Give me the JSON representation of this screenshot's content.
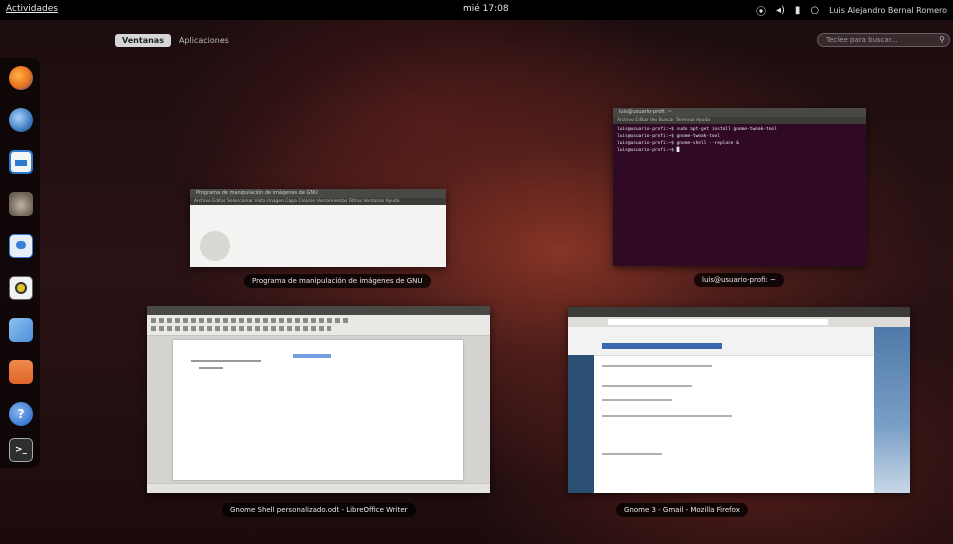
{
  "top_panel": {
    "activities_label": "Actividades",
    "clock": "mié 17:08",
    "user_name": "Luis Alejandro Bernal Romero"
  },
  "view_selector": {
    "windows_tab": "Ventanas",
    "applications_tab": "Aplicaciones"
  },
  "search": {
    "placeholder": "Teclee para buscar..."
  },
  "dash": {
    "items": [
      {
        "name": "firefox-icon",
        "color": "#e8731f"
      },
      {
        "name": "thunderbird-icon",
        "color": "#2f6fb4"
      },
      {
        "name": "libreoffice-writer-icon",
        "color": "#2a7bd0"
      },
      {
        "name": "gimp-icon",
        "color": "#8d8072"
      },
      {
        "name": "empathy-icon",
        "color": "#3b7ed6"
      },
      {
        "name": "rhythmbox-icon",
        "color": "#e2c325"
      },
      {
        "name": "shotwell-icon",
        "color": "#4b8ed8"
      },
      {
        "name": "files-icon",
        "color": "#e0642a"
      },
      {
        "name": "help-icon",
        "color": "#3b7ad0"
      },
      {
        "name": "terminal-icon",
        "color": "#2e2e2e"
      }
    ]
  },
  "windows": {
    "gimp": {
      "caption": "Programa de manipulación de imágenes de GNU",
      "title": "Programa de manipulación de imágenes de GNU",
      "menu": "Archivo  Editar  Seleccionar  Vista  Imagen  Capa  Colores  Herramientas  Filtros  Ventanas  Ayuda"
    },
    "terminal": {
      "caption": "luis@usuario-profi: ~",
      "title": "luis@usuario-profi: ~",
      "menu": "Archivo  Editar  Ver  Buscar  Terminal  Ayuda",
      "lines": [
        "luis@usuario-profi:~$ sudo apt-get install gnome-tweak-tool",
        "luis@usuario-profi:~$ gnome-tweak-tool",
        "luis@usuario-profi:~$ gnome-shell --replace &",
        "luis@usuario-profi:~$ █"
      ]
    },
    "writer": {
      "caption": "Gnome Shell personalizado.odt - LibreOffice Writer"
    },
    "firefox": {
      "caption": "Gnome 3 - Gmail - Mozilla Firefox"
    }
  }
}
